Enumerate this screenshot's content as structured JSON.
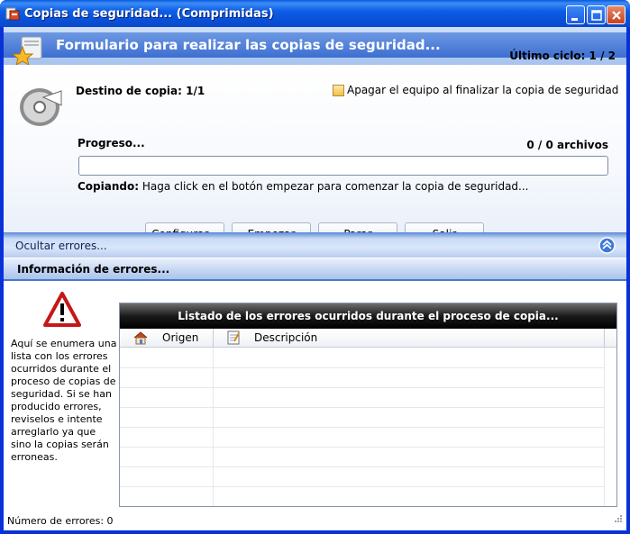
{
  "window": {
    "title": "Copias de seguridad... (Comprimidas)",
    "controls": [
      "minimize-icon",
      "maximize-icon",
      "close-icon"
    ]
  },
  "banner": {
    "title": "Formulario para realizar las copias de seguridad...",
    "cycle": "Último ciclo: 1 / 2"
  },
  "copy": {
    "destination": "Destino de copia: 1/1",
    "shutdown_option": "Apagar el equipo al finalizar la copia de seguridad",
    "shutdown_checked": false,
    "progress_label": "Progreso...",
    "progress_value": 0,
    "files_count": "0 / 0 archivos",
    "status_prefix": "Copiando:",
    "status_text": " Haga click en el botón empezar para comenzar la copia de seguridad..."
  },
  "buttons": {
    "configure": "Configurar...",
    "start": "Empezar",
    "stop": "Parar",
    "exit": "Salir"
  },
  "errors": {
    "toggle_label": "Ocultar errores...",
    "header": "Información de errores...",
    "description": "Aquí se enumera una lista con los errores ocurridos durante el proceso de copias de seguridad. Si se han producido errores, reviselos e intente arreglarlo ya que sino la copias serán erroneas.",
    "count": "Número de errores: 0",
    "list_title": "Listado de los errores ocurridos durante el proceso de copia...",
    "columns": [
      "Origen",
      "Descripción"
    ],
    "rows": []
  },
  "colors": {
    "titlebar": "#0a5ae0",
    "banner": "#3d6fd1",
    "accent": "#4c78c8"
  }
}
